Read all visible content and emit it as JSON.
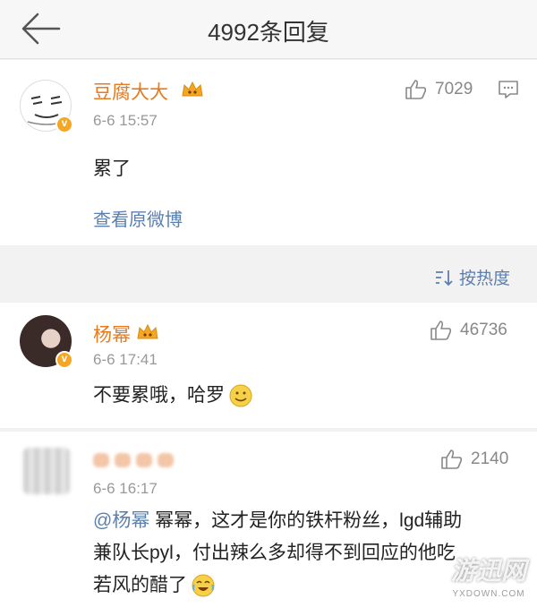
{
  "header": {
    "title": "4992条回复"
  },
  "original_post": {
    "username": "豆腐大大",
    "time": "6-6 15:57",
    "likes": "7029",
    "content": "累了",
    "view_original": "查看原微博"
  },
  "sort": {
    "label": "按热度"
  },
  "replies": [
    {
      "username": "杨幂",
      "time": "6-6 17:41",
      "likes": "46736",
      "content": "不要累哦，哈罗"
    },
    {
      "username": "",
      "time": "6-6 16:17",
      "likes": "2140",
      "mention": "@杨幂",
      "content_line1": " 幂幂，这才是你的铁杆粉丝，lgd辅助",
      "content_line2": "兼队长pyl，付出辣么多却得不到回应的他吃",
      "content_line3": "若风的醋了"
    }
  ],
  "watermark": {
    "logo": "游迅网",
    "domain": "YXDOWN.COM"
  },
  "colors": {
    "username": "#e57a1f",
    "link": "#5b7fae",
    "timestamp": "#999999",
    "badge": "#f5a623"
  }
}
